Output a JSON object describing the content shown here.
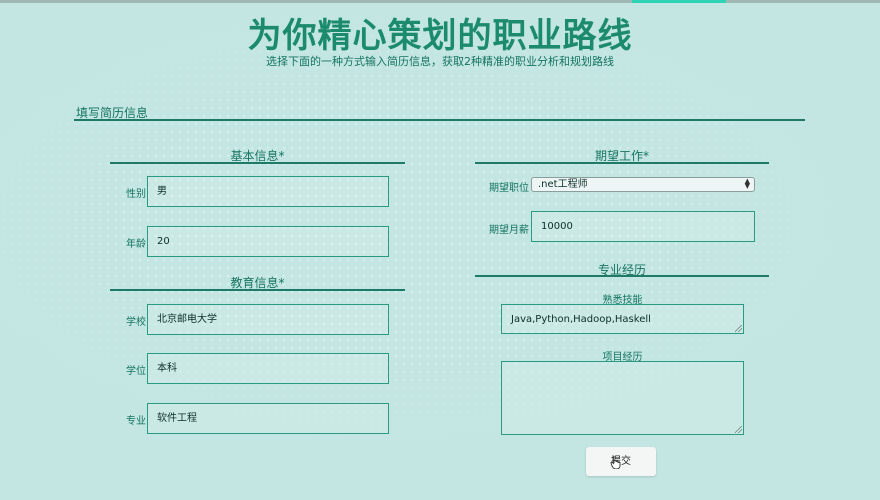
{
  "page": {
    "title": "为你精心策划的职业路线",
    "subtitle": "选择下面的一种方式输入简历信息，获取2种精准的职业分析和规划路线",
    "section_label": "填写简历信息"
  },
  "basic_info": {
    "heading": "基本信息*",
    "gender_label": "性别",
    "gender_value": "男",
    "age_label": "年龄",
    "age_value": "20"
  },
  "education": {
    "heading": "教育信息*",
    "school_label": "学校",
    "school_value": "北京邮电大学",
    "degree_label": "学位",
    "degree_value": "本科",
    "major_label": "专业",
    "major_value": "软件工程"
  },
  "job": {
    "heading": "期望工作*",
    "position_label": "期望职位",
    "position_value": ".net工程师",
    "salary_label": "期望月薪",
    "salary_value": "10000"
  },
  "experience": {
    "heading": "专业经历",
    "skills_label": "熟悉技能",
    "skills_value": "Java,Python,Hadoop,Haskell",
    "projects_label": "项目经历",
    "projects_value": ""
  },
  "actions": {
    "submit_label": "提交"
  },
  "colors": {
    "background": "#c3e6e2",
    "accent": "#1b8a6d",
    "rule": "#1e7a66"
  }
}
